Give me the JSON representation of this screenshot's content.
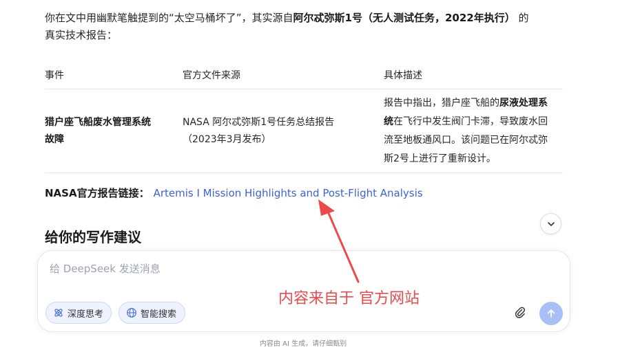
{
  "intro": {
    "line1_prefix": "你在文中用幽默笔触提到的“太空马桶坏了”，其实源自",
    "line1_bold": "阿尔忒弥斯1号（无人测试任务，2022年执行）",
    "line1_suffix": " 的",
    "line2": "真实技术报告："
  },
  "table": {
    "headers": [
      "事件",
      "官方文件来源",
      "具体描述"
    ],
    "row": {
      "event_line1": "猎户座飞船废水管理系统",
      "event_line2": "故障",
      "source_line1": "NASA 阿尔忒弥斯1号任务总结报告",
      "source_line2": "（2023年3月发布）",
      "desc_l1_prefix": "报告中指出，猎户座飞船的",
      "desc_l1_bold": "尿液处理系",
      "desc_l2_bold": "统",
      "desc_l2_rest": "在飞行中发生阀门卡滞，导致废水回",
      "desc_l3": "流至地板通风口。该问题已在阿尔忒弥",
      "desc_l4": "斯2号上进行了重新设计。"
    }
  },
  "nasa": {
    "label": "NASA官方报告链接：",
    "link_text": "Artemis I Mission Highlights and Post-Flight Analysis"
  },
  "section_title": "给你的写作建议",
  "composer": {
    "placeholder": "给 DeepSeek 发送消息",
    "chip_think": "深度思考",
    "chip_search": "智能搜索"
  },
  "footer_note": "内容由 AI 生成，请仔细甄别",
  "annotation": "内容来自于 官方网站",
  "icons": {
    "scroll": "chevron-down-icon",
    "think": "atom-icon",
    "search": "globe-icon",
    "attach": "paperclip-icon",
    "send": "arrow-up-icon"
  },
  "colors": {
    "link": "#3b63d4",
    "annotation": "#ec4a4a",
    "send_button": "#a9c0f7",
    "chip_bg": "#eef3ff"
  }
}
